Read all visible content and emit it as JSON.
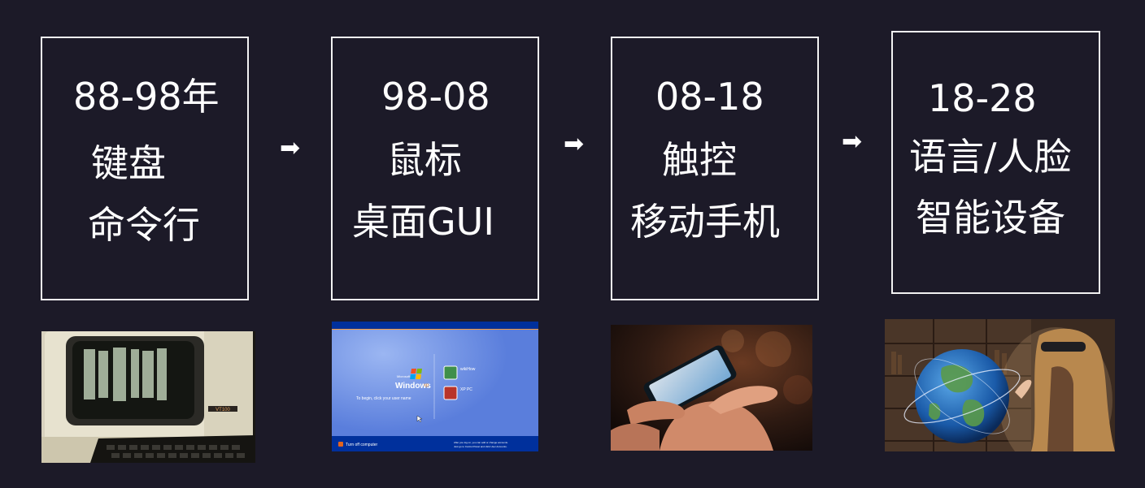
{
  "eras": [
    {
      "years": "88-98年",
      "lines": [
        "键盘",
        "命令行"
      ]
    },
    {
      "years": "98-08",
      "lines": [
        "鼠标",
        "桌面GUI"
      ]
    },
    {
      "years": "08-18",
      "lines": [
        "触控",
        "移动手机"
      ]
    },
    {
      "years": "18-28",
      "lines": [
        "语言/人脸",
        "智能设备"
      ]
    }
  ],
  "arrow_glyph": "➡",
  "xp_screen": {
    "logo_small": "Microsoft",
    "logo": "Windows",
    "logo_suffix": "xp",
    "instruction": "To begin, click your user name",
    "users": [
      "wikiHow",
      "XP PC"
    ],
    "turn_off": "Turn off computer",
    "footer_line1": "After you log on, you can add or change accounts.",
    "footer_line2": "Just go to Control Panel and click User Accounts."
  },
  "terminal_brand": "VT100",
  "colors": {
    "background": "#1c1a28",
    "border": "#f2f2f2",
    "text": "#ffffff",
    "xp_blue": "#5a7edc",
    "xp_dark": "#00309c"
  }
}
